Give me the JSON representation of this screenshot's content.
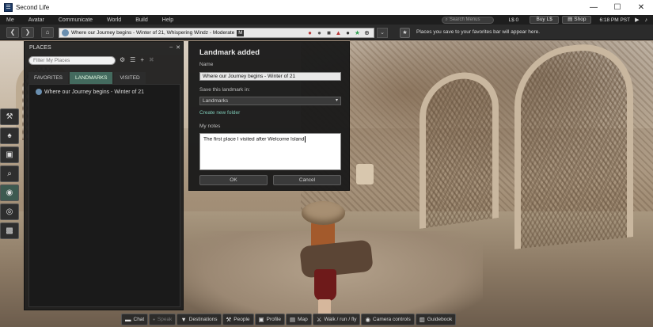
{
  "window": {
    "title": "Second Life",
    "icon_glyph": "☰",
    "minimize_glyph": "—",
    "maximize_glyph": "☐",
    "close_glyph": "✕"
  },
  "menubar": {
    "items": [
      "Me",
      "Avatar",
      "Communicate",
      "World",
      "Build",
      "Help"
    ],
    "search_placeholder": "Search Menus",
    "search_icon_glyph": "⌕",
    "balance": "L$ 0",
    "buy_label": "Buy L$",
    "shop_label": "Shop",
    "shop_icon_glyph": "▤",
    "clock": "6:18 PM PST",
    "media_icon_glyph": "▶",
    "volume_icon_glyph": "♪"
  },
  "navbar": {
    "back_glyph": "❮",
    "forward_glyph": "❯",
    "home_glyph": "⌂",
    "location": "Where our Journey begins - Winter of 21, Whispering Windz - Moderate",
    "maturity_badge": "M",
    "location_tools": [
      {
        "icon": "voice-off-icon",
        "glyph": "●",
        "color": "#b83a3a"
      },
      {
        "icon": "no-fly-icon",
        "glyph": "●",
        "color": "#555555"
      },
      {
        "icon": "no-build-icon",
        "glyph": "■",
        "color": "#444444"
      },
      {
        "icon": "no-scripts-icon",
        "glyph": "▲",
        "color": "#b83a3a"
      },
      {
        "icon": "no-push-icon",
        "glyph": "●",
        "color": "#333333"
      },
      {
        "icon": "favorite-star-icon",
        "glyph": "★",
        "color": "#2e9e4e"
      },
      {
        "icon": "add-landmark-icon",
        "glyph": "⊕",
        "color": "#333333"
      }
    ],
    "dropdown_glyph": "⌄",
    "favorites_icon_glyph": "★",
    "favorites_hint": "Places you save to your favorites bar will appear here."
  },
  "left_toolbar": {
    "buttons": [
      {
        "name": "people-tool-button",
        "icon": "people-icon",
        "glyph": "⚒"
      },
      {
        "name": "appearance-tool-button",
        "icon": "shirt-icon",
        "glyph": "♠"
      },
      {
        "name": "inventory-tool-button",
        "icon": "suitcase-icon",
        "glyph": "▣"
      },
      {
        "name": "search-tool-button",
        "icon": "search-icon",
        "glyph": "⌕"
      },
      {
        "name": "places-tool-button",
        "icon": "globe-icon",
        "glyph": "◉",
        "active": true
      },
      {
        "name": "radar-tool-button",
        "icon": "radar-icon",
        "glyph": "◎"
      },
      {
        "name": "snapshot-tool-button",
        "icon": "camera-icon",
        "glyph": "▩"
      }
    ]
  },
  "places": {
    "title": "PLACES",
    "minimize_glyph": "–",
    "close_glyph": "✕",
    "filter_placeholder": "Filter My Places",
    "gear_glyph": "⚙",
    "sort_glyph": "☰",
    "add_glyph": "+",
    "trash_glyph": "✖",
    "tabs": [
      "FAVORITES",
      "LANDMARKS",
      "VISITED"
    ],
    "active_tab": "LANDMARKS",
    "items": [
      "Where our Journey begins - Winter of 21"
    ]
  },
  "landmark_dialog": {
    "title": "Landmark added",
    "name_label": "Name",
    "name_value": "Where our Journey begins - Winter of 21",
    "folder_label": "Save this landmark in:",
    "folder_value": "Landmarks",
    "folder_caret": "▾",
    "create_folder_link": "Create new folder",
    "notes_label": "My notes",
    "notes_value": "The first place I visited after Welcome Island",
    "ok_label": "OK",
    "cancel_label": "Cancel"
  },
  "bottom_bar": {
    "buttons": [
      {
        "name": "chat-button",
        "icon": "chat-bubble-icon",
        "glyph": "▬",
        "label": "Chat",
        "disabled": false
      },
      {
        "name": "speak-button",
        "icon": "microphone-icon",
        "glyph": "•",
        "label": "Speak",
        "disabled": true
      },
      {
        "name": "destinations-button",
        "icon": "map-pin-icon",
        "glyph": "▼",
        "label": "Destinations",
        "disabled": false
      },
      {
        "name": "people-button",
        "icon": "people-icon",
        "glyph": "⚒",
        "label": "People",
        "disabled": false
      },
      {
        "name": "profile-button",
        "icon": "profile-card-icon",
        "glyph": "▣",
        "label": "Profile",
        "disabled": false
      },
      {
        "name": "map-button",
        "icon": "map-icon",
        "glyph": "▤",
        "label": "Map",
        "disabled": false
      },
      {
        "name": "walk-run-fly-button",
        "icon": "walking-figure-icon",
        "glyph": "⚔",
        "label": "Walk / run / fly",
        "disabled": false
      },
      {
        "name": "camera-controls-button",
        "icon": "eye-icon",
        "glyph": "◉",
        "label": "Camera controls",
        "disabled": false
      },
      {
        "name": "guidebook-button",
        "icon": "book-icon",
        "glyph": "▥",
        "label": "Guidebook",
        "disabled": false
      }
    ]
  },
  "colors": {
    "accent_tab": "#436a5e",
    "link": "#7ec9b6",
    "panel_bg": "#1c1c1c"
  }
}
